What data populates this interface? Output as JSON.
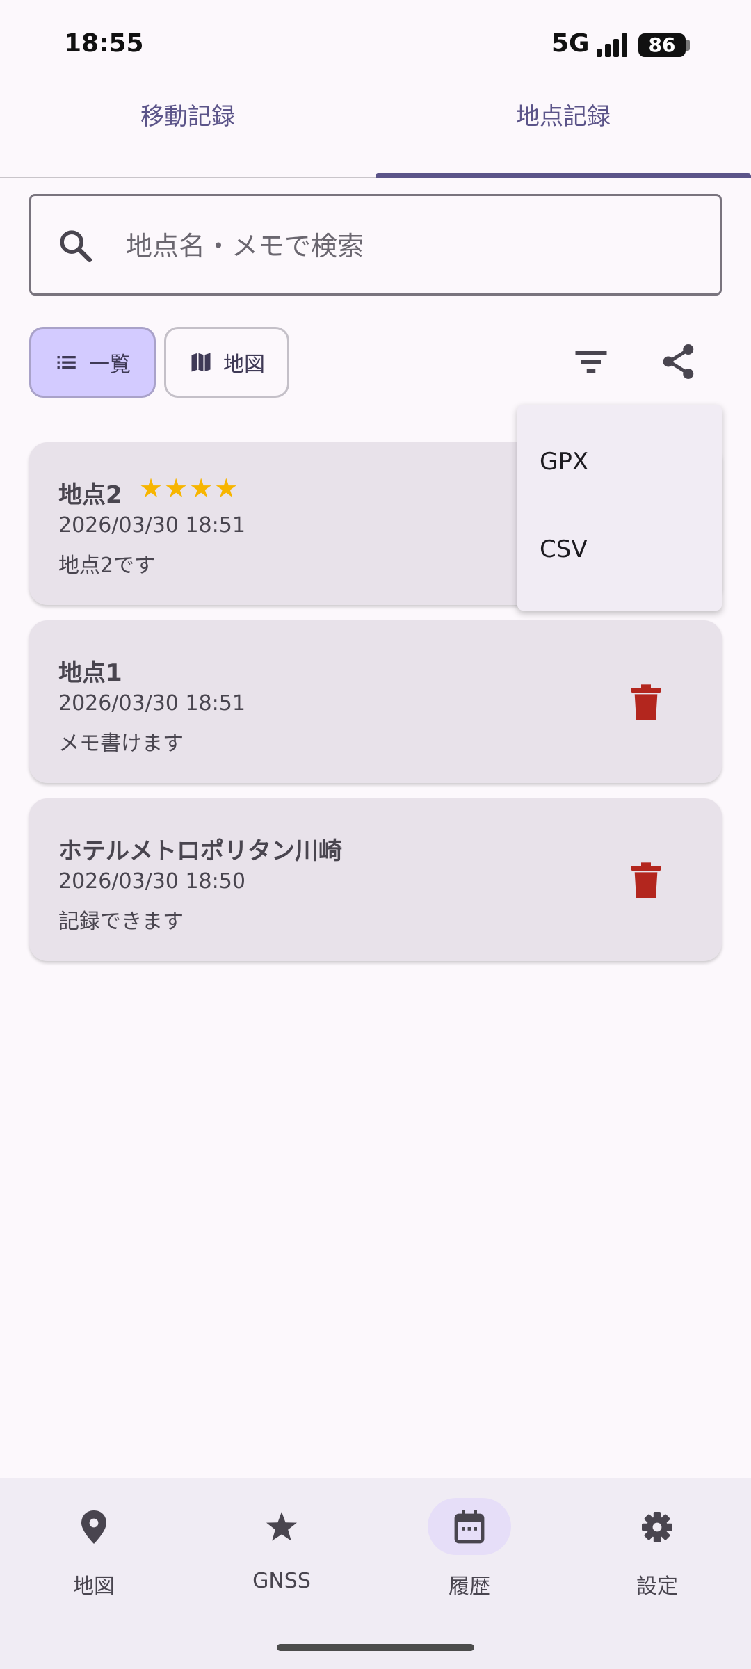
{
  "status_bar": {
    "time": "18:55",
    "network": "5G",
    "battery": "86"
  },
  "tabs": [
    {
      "label": "移動記録",
      "selected": false
    },
    {
      "label": "地点記録",
      "selected": true
    }
  ],
  "search": {
    "placeholder": "地点名・メモで検索",
    "icon": "search-icon"
  },
  "view_toggle": {
    "list_label": "一覧",
    "map_label": "地図",
    "selected": "一覧"
  },
  "toolbar": {
    "filter_icon": "filter-icon",
    "share_icon": "share-icon"
  },
  "export_menu": {
    "items": [
      "GPX",
      "CSV"
    ]
  },
  "places": [
    {
      "name": "地点2",
      "stars": "★★★★",
      "rating": 4,
      "date": "2026/03/30 18:51",
      "memo": "地点2です"
    },
    {
      "name": "地点1",
      "stars": "",
      "rating": 0,
      "date": "2026/03/30 18:51",
      "memo": "メモ書けます"
    },
    {
      "name": "ホテルメトロポリタン川崎",
      "stars": "",
      "rating": 0,
      "date": "2026/03/30 18:50",
      "memo": "記録できます"
    }
  ],
  "colors": {
    "accent": "#5b5489",
    "selected_chip": "#d3cbff",
    "card": "#e8e2ea",
    "star": "#f7b500",
    "delete": "#b3261e"
  },
  "bottom_nav": [
    {
      "label": "地図",
      "icon": "location-pin-icon",
      "active": false
    },
    {
      "label": "GNSS",
      "icon": "star-icon",
      "active": false
    },
    {
      "label": "履歴",
      "icon": "calendar-icon",
      "active": true
    },
    {
      "label": "設定",
      "icon": "gear-icon",
      "active": false
    }
  ]
}
